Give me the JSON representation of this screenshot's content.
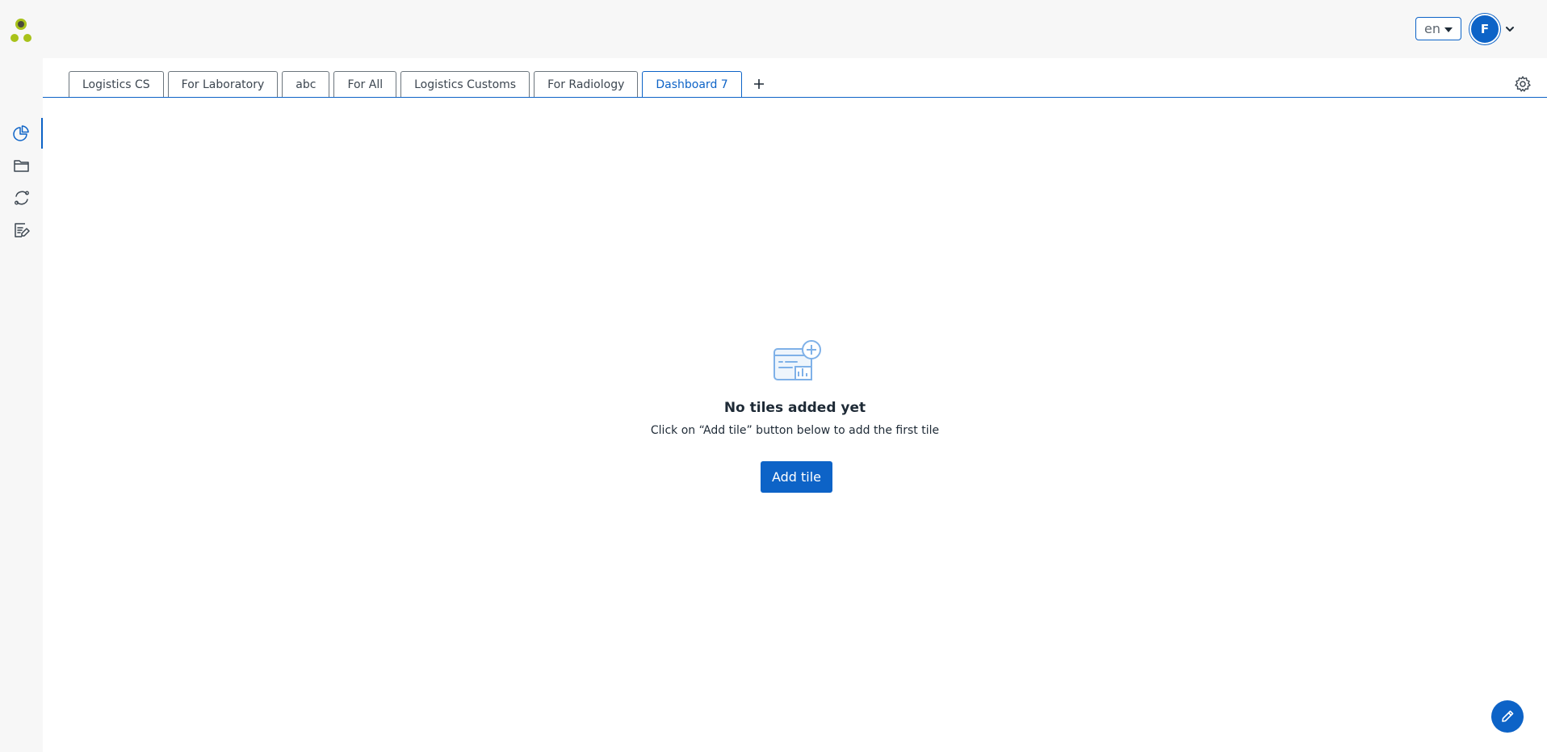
{
  "header": {
    "language": "en",
    "user_initial": "F"
  },
  "sidebar": {
    "items": [
      {
        "icon": "pie-chart-icon",
        "active": true
      },
      {
        "icon": "folder-icon",
        "active": false
      },
      {
        "icon": "refresh-icon",
        "active": false
      },
      {
        "icon": "edit-list-icon",
        "active": false
      }
    ]
  },
  "tabs": [
    {
      "label": "Logistics CS"
    },
    {
      "label": "For Laboratory"
    },
    {
      "label": "abc"
    },
    {
      "label": "For All"
    },
    {
      "label": "Logistics Customs"
    },
    {
      "label": "For Radiology"
    },
    {
      "label": "Dashboard 7",
      "active": true
    }
  ],
  "empty_state": {
    "title": "No tiles added yet",
    "subtitle": "Click on “Add tile” button below to add the first tile",
    "button_label": "Add tile"
  },
  "colors": {
    "accent": "#0d63c7",
    "logo_dark": "#4a4a3c",
    "logo_green": "#a8c21a"
  }
}
